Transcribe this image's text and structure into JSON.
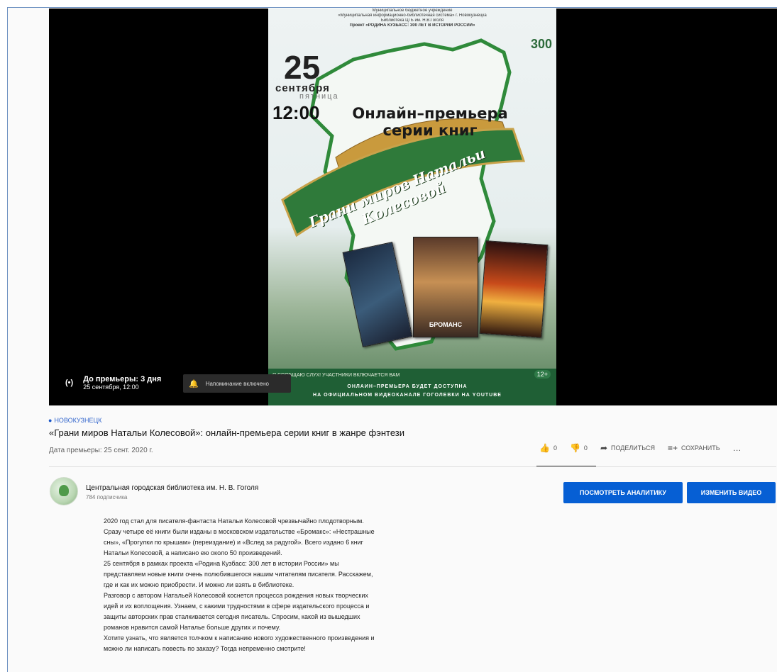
{
  "poster": {
    "header_lines": [
      "Муниципальное бюджетное учреждение",
      "«Муниципальная информационно-библиотечная система» г. Новокузнецка",
      "Библиотека ЦГБ им. Н.В.Гоголя",
      "Проект «РОДИНА КУЗБАСС: 300 ЛЕТ В ИСТОРИИ РОССИИ»"
    ],
    "badge_300": "300",
    "day": "25",
    "month": "сентября",
    "weekday": "пятница",
    "time": "12:00",
    "premiere_text": "Онлайн–премьера серии книг",
    "ribbon_text": "Грани миров Натальи Колесовой",
    "book_label": "БРОМАНС",
    "slogan": "Я СООБЩАЮ СЛУХ! УЧАСТНИКИ ВКЛЮЧАЕТСЯ ВАМ",
    "footer_line1": "ОНЛАЙН–ПРЕМЬЕРА БУДЕТ ДОСТУПНА",
    "footer_line2": "НА ОФИЦИАЛЬНОМ ВИДЕОКАНАЛЕ ГОГОЛЕВКИ НА YOUTUBE",
    "age": "12+"
  },
  "player": {
    "live_icon": "(•)",
    "countdown_main": "До премьеры: 3 дня",
    "countdown_sub": "25 сентября, 12:00",
    "notify_label": "Напоминание включено"
  },
  "video": {
    "tag": "НОВОКУЗНЕЦК",
    "title": "«Грани миров Натальи Колесовой»: онлайн-премьера серии книг в жанре фэнтези",
    "premiere_date": "Дата премьеры: 25 сент. 2020 г."
  },
  "actions": {
    "likes": "0",
    "dislikes": "0",
    "share": "ПОДЕЛИТЬСЯ",
    "save": "СОХРАНИТЬ",
    "more": "…"
  },
  "channel": {
    "name": "Центральная городская библиотека им. Н. В. Гоголя",
    "subscribers": "784 подписчика"
  },
  "buttons": {
    "analytics": "ПОСМОТРЕТЬ АНАЛИТИКУ",
    "edit": "ИЗМЕНИТЬ ВИДЕО"
  },
  "description": [
    "2020 год стал для писателя-фантаста Натальи Колесовой чрезвычайно плодотворным.",
    "Сразу четыре её книги были изданы в московском издательстве «Бромакс»: «Нестрашные",
    "сны», «Прогулки по крышам» (переиздание) и «Вслед за радугой». Всего издано 6 книг",
    "Натальи Колесовой, а написано ею около 50 произведений.",
    "25 сентября в рамках проекта «Родина Кузбасс: 300 лет в истории России» мы",
    "представляем новые книги очень полюбившегося нашим читателям писателя. Расскажем,",
    "где и как их можно приобрести. И можно ли взять в библиотеке.",
    "Разговор с автором Натальей Колесовой коснется процесса рождения новых творческих",
    "идей и их воплощения. Узнаем, с какими трудностями в сфере издательского процесса и",
    "защиты авторских прав сталкивается сегодня писатель. Спросим, какой из вышедших",
    "романов нравится самой Наталье больше других и почему.",
    "Хотите узнать, что является толчком к написанию нового художественного произведения и",
    "можно ли написать повесть по заказу? Тогда непременно смотрите!"
  ],
  "colors": {
    "primary_button": "#065fd4",
    "link_blue": "#3366cc",
    "poster_green": "#1f5f35"
  }
}
